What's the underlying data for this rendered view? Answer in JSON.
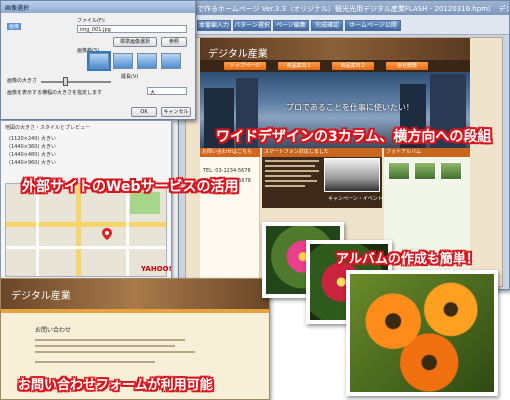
{
  "main_window": {
    "title": "自分で作るホームページ Ver.3.3（オリジナル）観光光用デジタル産業FLASH - 20120316.hpm）　デジタル産業",
    "tabs": [
      "本番編入力",
      "パターン選択",
      "ページ編集",
      "完成確認",
      "ホームページ公開"
    ]
  },
  "site_preview": {
    "name": "デジタル産業",
    "nav": [
      "トップページ",
      "商品案内１",
      "商品案内２",
      "会社概要"
    ],
    "hero_text": "プロであることを仕事に使いたい！",
    "left_header": "お問い合わせはこちら",
    "tel": "TEL: 03-1234-5678",
    "fax": "FAX: 03-1234-5678",
    "mid_header": "スマートフォン対応しました",
    "mid_caption": "キャンペーン・イベント",
    "right_header": "フォトアルバム"
  },
  "dialog": {
    "title": "画像選択",
    "tab_label": "画像",
    "file_label": "ファイル(F):",
    "file_value": "img_001.jpg",
    "btn_standard": "標準画像選択",
    "btn_ref": "参照",
    "style_label": "画像枠(S)",
    "size_label": "縦長(V)",
    "check_label": "画像の大きさ",
    "slider_hint": "画像を表示する横幅の大きさを指定します",
    "select_value": "大",
    "ok": "OK",
    "cancel": "キャンセル"
  },
  "map_panel": {
    "title": "地図の大きさ・スタイルとプレビュー",
    "sizes": [
      "(1120×240) 大きい",
      "(1440×360) 大きい",
      "(1440×480) 大きい",
      "(1440×960) 大きい"
    ],
    "map_logo": "YAHOO!"
  },
  "contact_page": {
    "name": "デジタル産業",
    "heading": "お問い合わせ"
  },
  "callouts": {
    "wide": "ワイドデザインの3カラム、横方向への段組",
    "web_service": "外部サイトのWebサービスの活用",
    "album": "アルバムの作成も簡単！",
    "contact": "お問い合わせフォームが利用可能"
  }
}
